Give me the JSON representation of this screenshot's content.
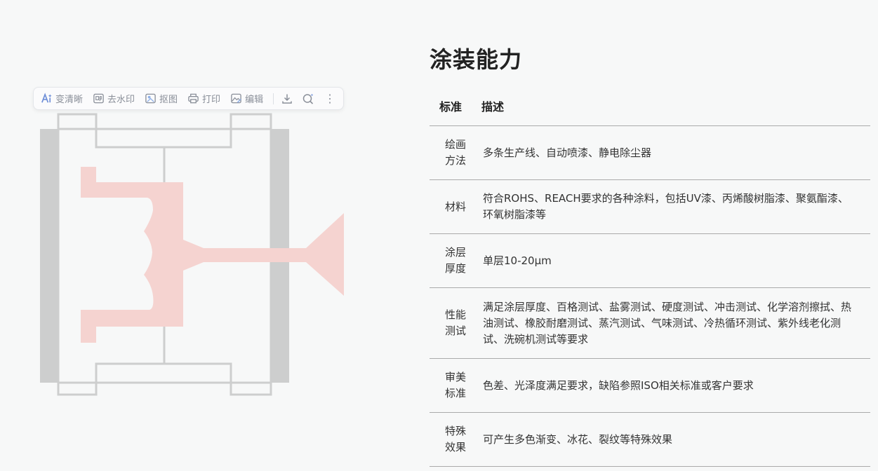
{
  "toolbar": {
    "items": [
      {
        "label": "变清晰",
        "icon": "ai-enhance-icon"
      },
      {
        "label": "去水印",
        "icon": "watermark-icon"
      },
      {
        "label": "抠图",
        "icon": "cutout-icon"
      },
      {
        "label": "打印",
        "icon": "printer-icon"
      },
      {
        "label": "编辑",
        "icon": "image-edit-icon"
      }
    ],
    "extra_icons": [
      "download-icon",
      "ai-search-icon",
      "more-icon"
    ]
  },
  "colors": {
    "diagram_gray": "#cdcece",
    "diagram_pink": "#f5d3d0",
    "table_border": "#aaaaaa",
    "background": "#f7f8f8"
  },
  "title": "涂装能力",
  "table": {
    "headers": [
      "标准",
      "描述"
    ],
    "rows": [
      {
        "label": "绘画\n方法",
        "desc": "多条生产线、自动喷漆、静电除尘器"
      },
      {
        "label": "材料",
        "desc": "符合ROHS、REACH要求的各种涂料，包括UV漆、丙烯酸树脂漆、聚氨酯漆、环氧树脂漆等"
      },
      {
        "label": "涂层\n厚度",
        "desc": "单层10-20μm"
      },
      {
        "label": "性能\n测试",
        "desc": "满足涂层厚度、百格测试、盐雾测试、硬度测试、冲击测试、化学溶剂擦拭、热油测试、橡胶耐磨测试、蒸汽测试、气味测试、冷热循环测试、紫外线老化测试、洗碗机测试等要求"
      },
      {
        "label": "审美\n标准",
        "desc": "色差、光泽度满足要求，缺陷参照ISO相关标准或客户要求"
      },
      {
        "label": "特殊\n效果",
        "desc": "可产生多色渐变、冰花、裂纹等特殊效果"
      }
    ]
  }
}
